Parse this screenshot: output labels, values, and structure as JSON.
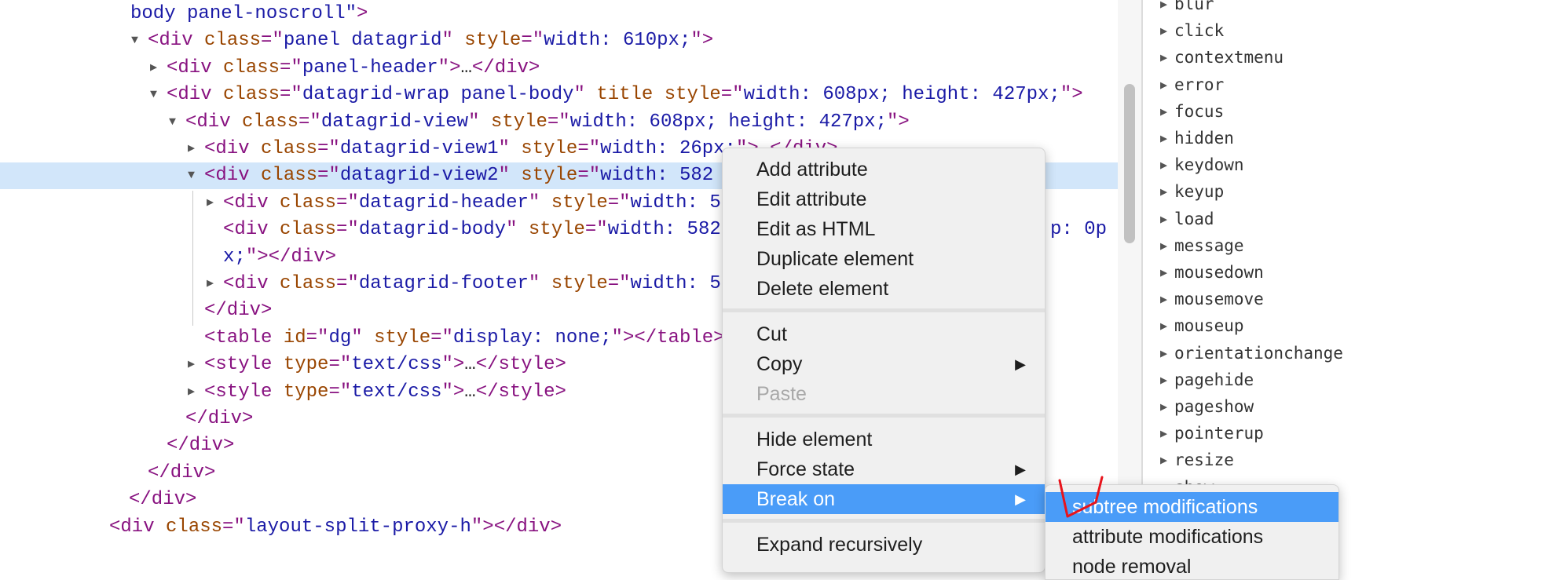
{
  "dom_lines": [
    {
      "level": -1,
      "arrow": "",
      "segs": [
        [
          "av",
          "body panel-noscroll\""
        ],
        [
          "t",
          ">"
        ]
      ]
    },
    {
      "level": 2,
      "arrow": "expanded",
      "segs": [
        [
          "t",
          "<div "
        ],
        [
          "an",
          "class"
        ],
        [
          "t",
          "=\""
        ],
        [
          "av",
          "panel datagrid"
        ],
        [
          "t",
          "\" "
        ],
        [
          "an",
          "style"
        ],
        [
          "t",
          "=\""
        ],
        [
          "av",
          "width: 610px;"
        ],
        [
          "t",
          "\">"
        ]
      ]
    },
    {
      "level": 3,
      "arrow": "collapsed",
      "segs": [
        [
          "t",
          "<div "
        ],
        [
          "an",
          "class"
        ],
        [
          "t",
          "=\""
        ],
        [
          "av",
          "panel-header"
        ],
        [
          "t",
          "\">"
        ],
        [
          "tx",
          "…"
        ],
        [
          "t",
          "</div>"
        ]
      ]
    },
    {
      "level": 3,
      "arrow": "expanded",
      "segs": [
        [
          "t",
          "<div "
        ],
        [
          "an",
          "class"
        ],
        [
          "t",
          "=\""
        ],
        [
          "av",
          "datagrid-wrap panel-body"
        ],
        [
          "t",
          "\" "
        ],
        [
          "an",
          "title"
        ],
        [
          "t",
          " "
        ],
        [
          "an",
          "style"
        ],
        [
          "t",
          "=\""
        ],
        [
          "av",
          "width: 608px; height: 427px;"
        ],
        [
          "t",
          "\">"
        ]
      ]
    },
    {
      "level": 4,
      "arrow": "expanded",
      "segs": [
        [
          "t",
          "<div "
        ],
        [
          "an",
          "class"
        ],
        [
          "t",
          "=\""
        ],
        [
          "av",
          "datagrid-view"
        ],
        [
          "t",
          "\" "
        ],
        [
          "an",
          "style"
        ],
        [
          "t",
          "=\""
        ],
        [
          "av",
          "width: 608px; height: 427px;"
        ],
        [
          "t",
          "\">"
        ]
      ]
    },
    {
      "level": 5,
      "arrow": "collapsed",
      "segs": [
        [
          "t",
          "<div "
        ],
        [
          "an",
          "class"
        ],
        [
          "t",
          "=\""
        ],
        [
          "av",
          "datagrid-view1"
        ],
        [
          "t",
          "\" "
        ],
        [
          "an",
          "style"
        ],
        [
          "t",
          "=\""
        ],
        [
          "av",
          "width: 26px;"
        ],
        [
          "t",
          "\">"
        ],
        [
          "tx",
          "…"
        ],
        [
          "t",
          "</div>"
        ]
      ]
    },
    {
      "level": 5,
      "arrow": "expanded",
      "selected": true,
      "segs": [
        [
          "t",
          "<div "
        ],
        [
          "an",
          "class"
        ],
        [
          "t",
          "=\""
        ],
        [
          "av",
          "datagrid-view2"
        ],
        [
          "t",
          "\" "
        ],
        [
          "an",
          "style"
        ],
        [
          "t",
          "=\""
        ],
        [
          "av",
          "width: 582"
        ]
      ]
    },
    {
      "level": 6,
      "arrow": "collapsed",
      "segs": [
        [
          "t",
          "<div "
        ],
        [
          "an",
          "class"
        ],
        [
          "t",
          "=\""
        ],
        [
          "av",
          "datagrid-header"
        ],
        [
          "t",
          "\" "
        ],
        [
          "an",
          "style"
        ],
        [
          "t",
          "=\""
        ],
        [
          "av",
          "width: 5"
        ]
      ]
    },
    {
      "level": 6,
      "arrow": "",
      "segs": [
        [
          "t",
          "<div "
        ],
        [
          "an",
          "class"
        ],
        [
          "t",
          "=\""
        ],
        [
          "av",
          "datagrid-body"
        ],
        [
          "t",
          "\" "
        ],
        [
          "an",
          "style"
        ],
        [
          "t",
          "=\""
        ],
        [
          "av",
          "width: 582"
        ]
      ],
      "tail": "p: 0p"
    },
    {
      "level": 6,
      "arrow": "",
      "segs": [
        [
          "av",
          "x;"
        ],
        [
          "t",
          "\"></div>"
        ]
      ]
    },
    {
      "level": 6,
      "arrow": "collapsed",
      "segs": [
        [
          "t",
          "<div "
        ],
        [
          "an",
          "class"
        ],
        [
          "t",
          "=\""
        ],
        [
          "av",
          "datagrid-footer"
        ],
        [
          "t",
          "\" "
        ],
        [
          "an",
          "style"
        ],
        [
          "t",
          "=\""
        ],
        [
          "av",
          "width: 5"
        ]
      ]
    },
    {
      "level": 5,
      "arrow": "",
      "segs": [
        [
          "t",
          "</div>"
        ]
      ]
    },
    {
      "level": 5,
      "arrow": "",
      "segs": [
        [
          "t",
          "<table "
        ],
        [
          "an",
          "id"
        ],
        [
          "t",
          "=\""
        ],
        [
          "av",
          "dg"
        ],
        [
          "t",
          "\" "
        ],
        [
          "an",
          "style"
        ],
        [
          "t",
          "=\""
        ],
        [
          "av",
          "display: none;"
        ],
        [
          "t",
          "\"></table>"
        ]
      ]
    },
    {
      "level": 5,
      "arrow": "collapsed",
      "segs": [
        [
          "t",
          "<style "
        ],
        [
          "an",
          "type"
        ],
        [
          "t",
          "=\""
        ],
        [
          "av",
          "text/css"
        ],
        [
          "t",
          "\">"
        ],
        [
          "tx",
          "…"
        ],
        [
          "t",
          "</style>"
        ]
      ]
    },
    {
      "level": 5,
      "arrow": "collapsed",
      "segs": [
        [
          "t",
          "<style "
        ],
        [
          "an",
          "type"
        ],
        [
          "t",
          "=\""
        ],
        [
          "av",
          "text/css"
        ],
        [
          "t",
          "\">"
        ],
        [
          "tx",
          "…"
        ],
        [
          "t",
          "</style>"
        ]
      ]
    },
    {
      "level": 4,
      "arrow": "",
      "segs": [
        [
          "t",
          "</div>"
        ]
      ]
    },
    {
      "level": 3,
      "arrow": "",
      "segs": [
        [
          "t",
          "</div>"
        ]
      ]
    },
    {
      "level": 2,
      "arrow": "",
      "segs": [
        [
          "t",
          "</div>"
        ]
      ]
    },
    {
      "level": 1,
      "arrow": "",
      "segs": [
        [
          "t",
          "</div>"
        ]
      ]
    },
    {
      "level": 0,
      "arrow": "",
      "segs": [
        [
          "t",
          "<div "
        ],
        [
          "an",
          "class"
        ],
        [
          "t",
          "=\""
        ],
        [
          "av",
          "layout-split-proxy-h"
        ],
        [
          "t",
          "\"></div>"
        ]
      ]
    }
  ],
  "event_listeners": [
    "blur",
    "click",
    "contextmenu",
    "error",
    "focus",
    "hidden",
    "keydown",
    "keyup",
    "load",
    "message",
    "mousedown",
    "mousemove",
    "mouseup",
    "orientationchange",
    "pagehide",
    "pageshow",
    "pointerup",
    "resize",
    "show"
  ],
  "context_menu": {
    "groups": [
      [
        {
          "label": "Add attribute"
        },
        {
          "label": "Edit attribute"
        },
        {
          "label": "Edit as HTML"
        },
        {
          "label": "Duplicate element"
        },
        {
          "label": "Delete element"
        }
      ],
      [
        {
          "label": "Cut"
        },
        {
          "label": "Copy",
          "submenu": true
        },
        {
          "label": "Paste",
          "disabled": true
        }
      ],
      [
        {
          "label": "Hide element"
        },
        {
          "label": "Force state",
          "submenu": true
        },
        {
          "label": "Break on",
          "submenu": true,
          "highlighted": true
        }
      ],
      [
        {
          "label": "Expand recursively"
        }
      ]
    ]
  },
  "break_on_submenu": [
    {
      "label": "subtree modifications",
      "highlighted": true
    },
    {
      "label": "attribute modifications"
    },
    {
      "label": "node removal"
    }
  ],
  "colors": {
    "tag": "#881280",
    "attr_name": "#994500",
    "attr_value": "#1a1aa6",
    "selection": "#d2e6fa",
    "menu_highlight": "#4a9cf8",
    "annotation": "#e8141c"
  }
}
